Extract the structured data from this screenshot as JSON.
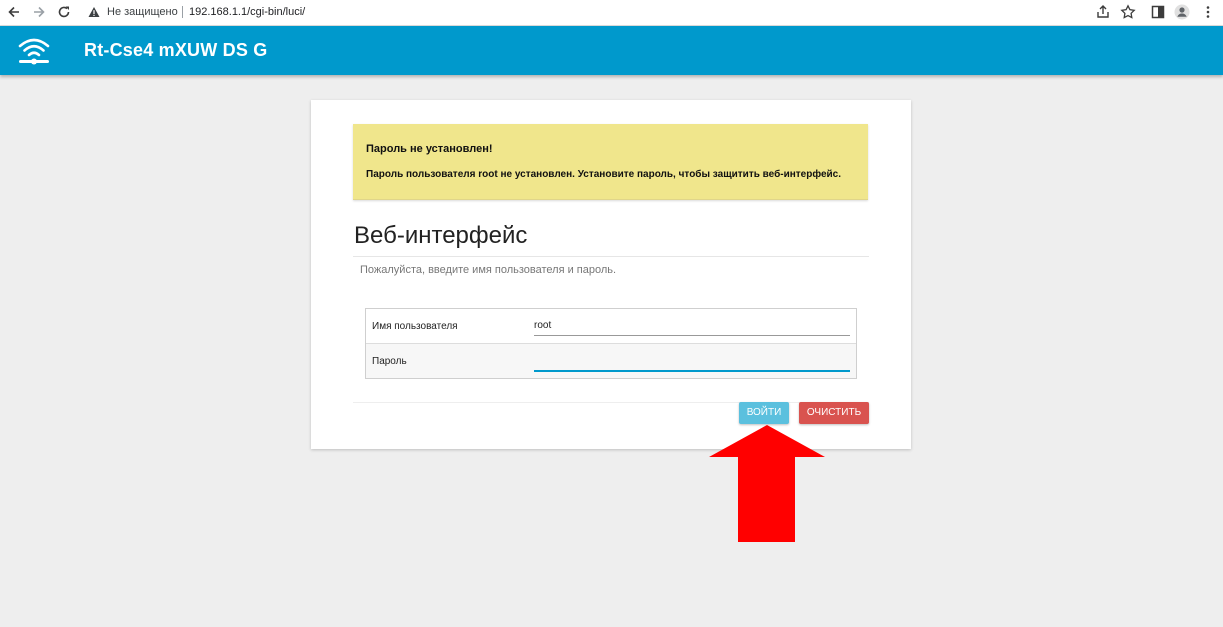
{
  "browser": {
    "security_label": "Не защищено",
    "url": "192.168.1.1/cgi-bin/luci/"
  },
  "header": {
    "brand": "Rt-Cse4 mXUW DS G",
    "logo_icon": "wifi-router-icon"
  },
  "alert": {
    "title": "Пароль не установлен!",
    "text": "Пароль пользователя root не установлен. Установите пароль, чтобы защитить веб-интерфейс."
  },
  "login": {
    "title": "Веб-интерфейс",
    "description": "Пожалуйста, введите имя пользователя и пароль.",
    "username_label": "Имя пользователя",
    "username_value": "root",
    "password_label": "Пароль",
    "password_value": "",
    "login_button": "ВОЙТИ",
    "reset_button": "ОЧИСТИТЬ"
  },
  "colors": {
    "header": "#0099cc",
    "alert_bg": "#f0e68c",
    "login_button": "#5bc0de",
    "reset_button": "#d9534f",
    "annotation_arrow": "#ff0000"
  }
}
